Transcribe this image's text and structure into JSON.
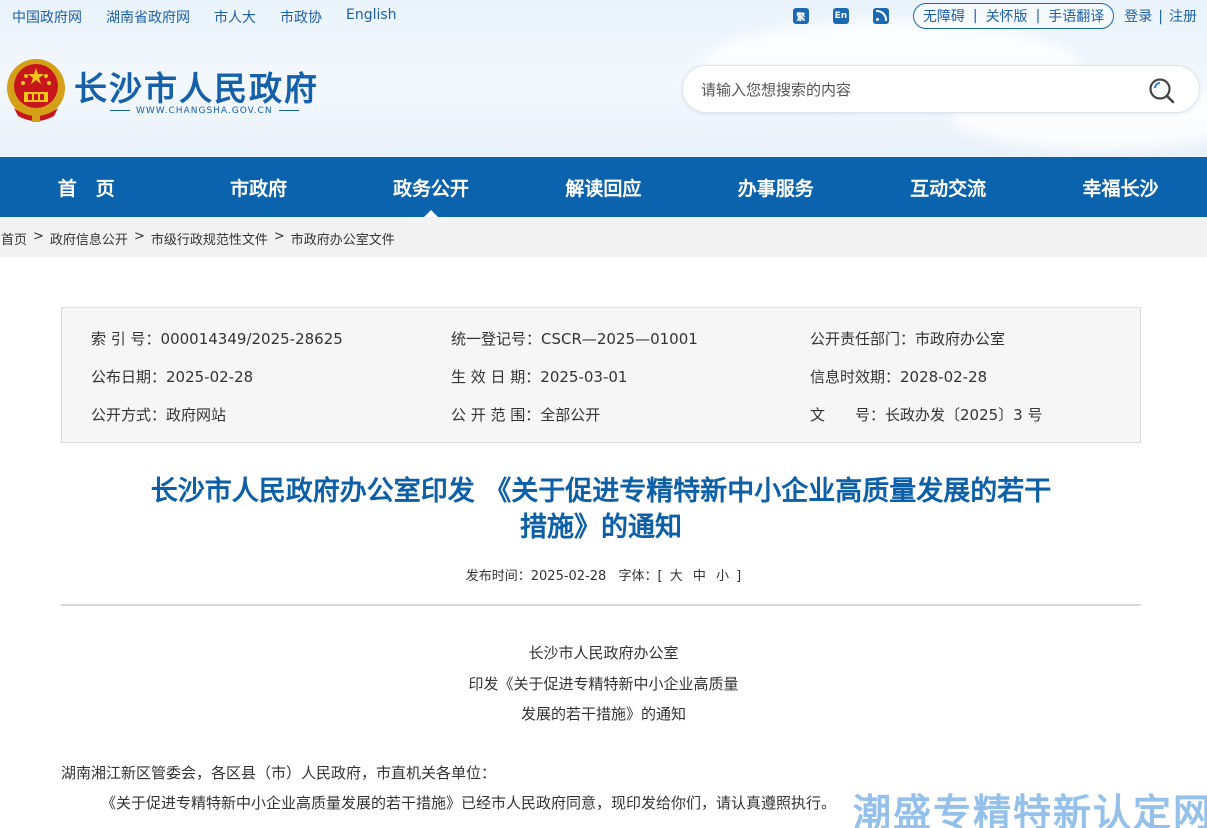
{
  "topbar": {
    "links": [
      "中国政府网",
      "湖南省政府网",
      "市人大",
      "市政协",
      "English"
    ],
    "icon_trad": "繁",
    "icon_en": "En",
    "access": [
      "无障碍",
      "关怀版",
      "手语翻译"
    ],
    "login": "登录",
    "register": "注册"
  },
  "site": {
    "title": "长沙市人民政府",
    "url": "WWW.CHANGSHA.GOV.CN"
  },
  "search": {
    "placeholder": "请输入您想搜索的内容"
  },
  "nav": [
    "首　页",
    "市政府",
    "政务公开",
    "解读回应",
    "办事服务",
    "互动交流",
    "幸福长沙"
  ],
  "breadcrumb": [
    "首页",
    "政府信息公开",
    "市级行政规范性文件",
    "市政府办公室文件"
  ],
  "info": {
    "index_no": "索 引 号：000014349/2025-28625",
    "reg_no": "统一登记号：CSCR—2025—01001",
    "dept": "公开责任部门：市政府办公室",
    "pub_date": "公布日期：2025-02-28",
    "eff_date": "生 效 日 期：2025-03-01",
    "expire": "信息时效期：2028-02-28",
    "method": "公开方式：政府网站",
    "scope": "公 开 范 围：全部公开",
    "doc_no": "文　　号：长政办发〔2025〕3 号"
  },
  "article": {
    "title_line1": "长沙市人民政府办公室印发 《关于促进专精特新中小企业高质量发展的若干",
    "title_line2": "措施》的通知",
    "date_label": "发布时间：",
    "date": "2025-02-28",
    "font_label": "字体：[",
    "font_big": "大",
    "font_mid": "中",
    "font_small": "小",
    "font_close": "]",
    "heading1": "长沙市人民政府办公室",
    "heading2": "印发《关于促进专精特新中小企业高质量",
    "heading3": "发展的若干措施》的通知",
    "addressee": "湖南湘江新区管委会，各区县（市）人民政府，市直机关各单位：",
    "body1": "《关于促进专精特新中小企业高质量发展的若干措施》已经市人民政府同意，现印发给你们，请认真遵照执行。"
  },
  "watermark": "潮盛专精特新认定网"
}
